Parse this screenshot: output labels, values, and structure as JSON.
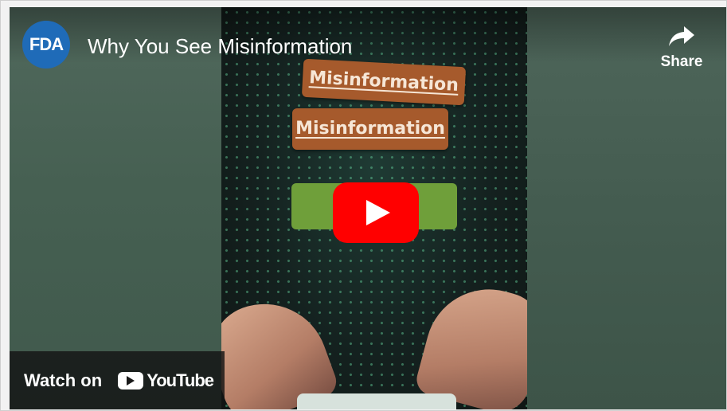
{
  "video": {
    "channel_avatar_text": "FDA",
    "title": "Why You See Misinformation"
  },
  "actions": {
    "share_label": "Share",
    "share_icon": "share-arrow-icon"
  },
  "thumbnail": {
    "tag_top": "Misinformation",
    "tag_bottom": "Misinformation"
  },
  "player": {
    "play_icon": "play-icon",
    "watch_on_label": "Watch on",
    "youtube_wordmark": "YouTube"
  },
  "colors": {
    "play_button": "#ff0000",
    "channel_avatar": "#1f6bb8",
    "tag_background": "#a65a2c",
    "green_bar": "#6f9f3a"
  }
}
